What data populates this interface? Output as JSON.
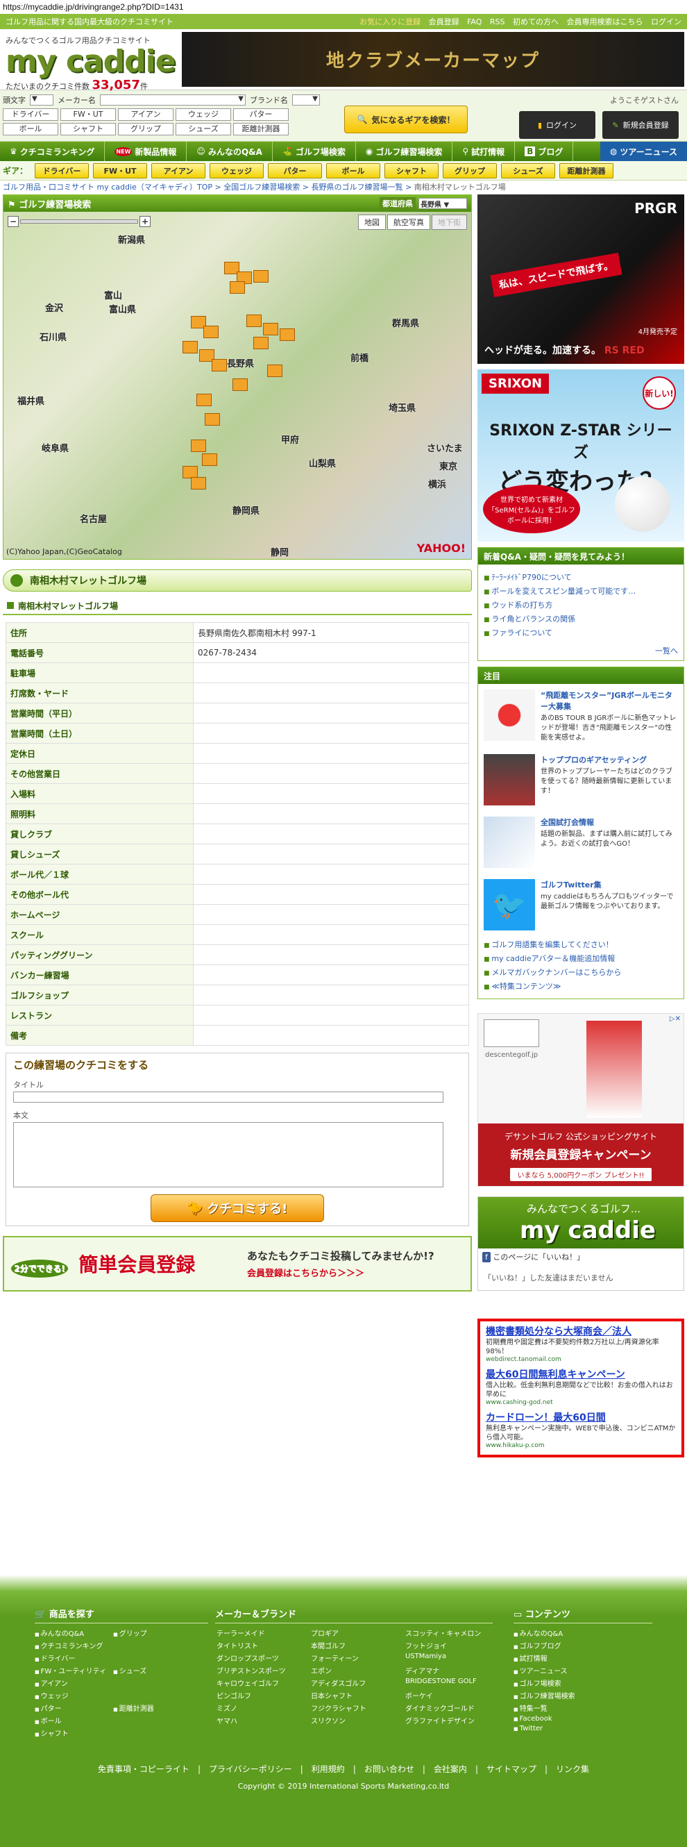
{
  "url": "https://mycaddie.jp/drivingrange2.php?DID=1431",
  "topbar": {
    "tagline": "ゴルフ用品に関する国内最大級のクチコミサイト",
    "links": [
      "お気に入りに登録",
      "会員登録",
      "FAQ",
      "RSS",
      "初めての方へ",
      "会員専用検索はこちら",
      "ログイン"
    ]
  },
  "header": {
    "catch": "みんなでつくるゴルフ用品クチコミサイト",
    "brand": "my caddie",
    "count_label": "ただいまのクチコミ件数",
    "count": "33,057",
    "count_unit": "件",
    "banner": "地クラブメーカーマップ"
  },
  "search": {
    "labels": [
      "頭文字",
      "メーカー名",
      "ブランド名"
    ],
    "gear_buttons": [
      "ドライバー",
      "FW・UT",
      "アイアン",
      "ウェッジ",
      "パター",
      "ボール",
      "シャフト",
      "グリップ",
      "シューズ",
      "距離計測器"
    ],
    "find_button": "気になるギアを検索！",
    "welcome": "ようこそゲストさん",
    "login": "ログイン",
    "register": "新規会員登録"
  },
  "gnav": [
    "クチコミランキング",
    "新製品情報",
    "みんなのQ&A",
    "ゴルフ場検索",
    "ゴルフ練習場検索",
    "試打情報",
    "ブログ",
    "ツアーニュース"
  ],
  "gearnav": {
    "label": "ギア：",
    "items": [
      "ドライバー",
      "FW・UT",
      "アイアン",
      "ウェッジ",
      "パター",
      "ボール",
      "シャフト",
      "グリップ",
      "シューズ",
      "距離計測器"
    ]
  },
  "breadcrumb": [
    "ゴルフ用品・口コミサイト my caddie（マイキャディ）TOP",
    "全国ゴルフ練習場検索",
    "長野県のゴルフ練習場一覧",
    "南相木村マレットゴルフ場"
  ],
  "map": {
    "title": "ゴルフ練習場検索",
    "pref_label": "都道府県",
    "pref_value": "長野県",
    "types": [
      "地図",
      "航空写真",
      "地下街"
    ],
    "places": [
      "新潟県",
      "富山",
      "富山県",
      "金沢",
      "石川県",
      "長野県",
      "前橋",
      "群馬県",
      "埼玉県",
      "岐阜県",
      "甲府",
      "山梨県",
      "さいたま",
      "東京",
      "横浜",
      "名古屋",
      "静岡県",
      "静岡",
      "福井県"
    ],
    "copyright": "(C)Yahoo Japan,(C)GeoCatalog",
    "yahoo": "YAHOO!"
  },
  "facility": {
    "heading": "南相木村マレットゴルフ場",
    "subheading": "南相木村マレットゴルフ場",
    "rows": [
      {
        "k": "住所",
        "v": "長野県南佐久郡南相木村 997-1"
      },
      {
        "k": "電話番号",
        "v": "0267-78-2434"
      },
      {
        "k": "駐車場",
        "v": ""
      },
      {
        "k": "打席数・ヤード",
        "v": ""
      },
      {
        "k": "営業時間（平日）",
        "v": ""
      },
      {
        "k": "営業時間（土日）",
        "v": ""
      },
      {
        "k": "定休日",
        "v": ""
      },
      {
        "k": "その他営業日",
        "v": ""
      },
      {
        "k": "入場料",
        "v": ""
      },
      {
        "k": "照明料",
        "v": ""
      },
      {
        "k": "貸しクラブ",
        "v": ""
      },
      {
        "k": "貸しシューズ",
        "v": ""
      },
      {
        "k": "ボール代／１球",
        "v": ""
      },
      {
        "k": "その他ボール代",
        "v": ""
      },
      {
        "k": "ホームページ",
        "v": ""
      },
      {
        "k": "スクール",
        "v": ""
      },
      {
        "k": "パッティンググリーン",
        "v": ""
      },
      {
        "k": "バンカー練習場",
        "v": ""
      },
      {
        "k": "ゴルフショップ",
        "v": ""
      },
      {
        "k": "レストラン",
        "v": ""
      },
      {
        "k": "備考",
        "v": ""
      }
    ]
  },
  "review": {
    "title": "この練習場のクチコミをする",
    "title_label": "タイトル",
    "body_label": "本文",
    "submit": "クチコミする!"
  },
  "reg_banner": {
    "left": "簡単会員登録",
    "badge": "2分でできる!",
    "right1": "あなたもクチコミ投稿してみませんか!?",
    "right2": "会員登録はこちらから＞＞＞"
  },
  "ads": {
    "prgr": {
      "logo": "PRGR",
      "copy": "私は、スピードで飛ばす。",
      "foot": "ヘッドが走る。加速する。",
      "model": "RS RED",
      "release": "4月発売予定"
    },
    "srixon": {
      "logo": "SRIXON",
      "new": "新しい!",
      "line1": "SRIXON Z-STAR シリーズ",
      "line2": "どう変わった？",
      "bubble": "世界で初めて新素材「SeRM(セルム)」をゴルフボールに採用！"
    },
    "descente": {
      "name": "descentegolf.jp",
      "line1": "デサントゴルフ 公式ショッピングサイト",
      "line2": "新規会員登録キャンペーン",
      "cta": "いまなら 5,000円クーポン プレゼント!!"
    }
  },
  "qa": {
    "head": "新着Q&A・疑問・疑問を見てみよう！",
    "items": [
      "ﾃｰﾗｰﾒｲﾄﾞP790について",
      "ボールを変えてスピン量減って可能です…",
      "ウッド系の打ち方",
      "ライ角とバランスの関係",
      "ファライについて"
    ],
    "more": "一覧へ"
  },
  "notice": {
    "head": "注目",
    "items": [
      {
        "t": "“飛距離モンスター”JGRボールモニター大募集",
        "d": "あのBS TOUR B JGRボールに新色マットレッドが登場！吉き\"飛距離モンスター\"の性能を実感せよ。"
      },
      {
        "t": "トッププロのギアセッティング",
        "d": "世界のトッププレーヤーたちはどのクラブを使ってる？随時最新情報に更新しています！"
      },
      {
        "t": "全国試打会情報",
        "d": "話題の新製品、まずは購入前に試打してみよう。お近くの試打会へGO！"
      },
      {
        "t": "ゴルフTwitter集",
        "d": "my caddieはもちろんプロもツイッターで最新ゴルフ情報をつぶやいております。"
      }
    ],
    "links": [
      "ゴルフ用語集を編集してください！",
      "my caddieアバター＆機能追加情報",
      "メルマガバックナンバーはこちらから",
      "≪特集コンテンツ≫"
    ]
  },
  "fb": {
    "t1": "みんなでつくるゴルフ...",
    "t2": "my caddie",
    "like": "このページに「いいね！」",
    "friends": "「いいね！」した友達はまだいません"
  },
  "textads": [
    {
      "h": "機密書類処分なら大塚商会／法人",
      "d": "初期費用や固定費は不要契約件数2万社以上/再資源化率98%！",
      "u": "webdirect.tanomail.com"
    },
    {
      "h": "最大60日間無利息キャンペーン",
      "d": "借入比較。低金利無利息期間などで比較！お金の借入れはお早めに",
      "u": "www.cashing-god.net"
    },
    {
      "h": "カードローン！最大60日間",
      "d": "無利息キャンペーン実施中。WEBで申込後、コンビニATMから借入可能。",
      "u": "www.hikaku-p.com"
    }
  ],
  "footer": {
    "head1": "商品を探す",
    "col1": [
      "みんなのQ&A",
      "クチコミランキング",
      "ドライバー",
      "FW・ユーティリティ",
      "アイアン",
      "ウェッジ",
      "パター",
      "ボール",
      "シャフト"
    ],
    "col2": [
      "グリップ",
      "シューズ",
      "距離計測器"
    ],
    "head_brands": "メーカー＆ブランド",
    "brands": [
      "テーラーメイド",
      "プロギア",
      "スコッティ・キャメロン",
      "タイトリスト",
      "本間ゴルフ",
      "フットジョイ",
      "ダンロップスポーツ",
      "フォーティーン",
      "USTMamiya",
      "ブリヂストンスポーツ",
      "エポン",
      "ディアマナ",
      "キャロウェイゴルフ",
      "アディダスゴルフ",
      "BRIDGESTONE GOLF",
      "ピンゴルフ",
      "日本シャフト",
      "ボーケイ",
      "ミズノ",
      "フジクラシャフト",
      "ダイナミックゴールド",
      "ヤマハ",
      "スリクソン",
      "グラファイトデザイン"
    ],
    "head2": "コンテンツ",
    "col3": [
      "みんなのQ&A",
      "ゴルフブログ",
      "試打情報",
      "ツアーニュース",
      "ゴルフ場検索",
      "ゴルフ練習場検索",
      "特集一覧",
      "Facebook",
      "Twitter"
    ],
    "links": [
      "免責事項・コピーライト",
      "プライバシーポリシー",
      "利用規約",
      "お問い合わせ",
      "会社案内",
      "サイトマップ",
      "リンク集"
    ],
    "copyright": "Copyright © 2019 International Sports Marketing,co.ltd"
  }
}
